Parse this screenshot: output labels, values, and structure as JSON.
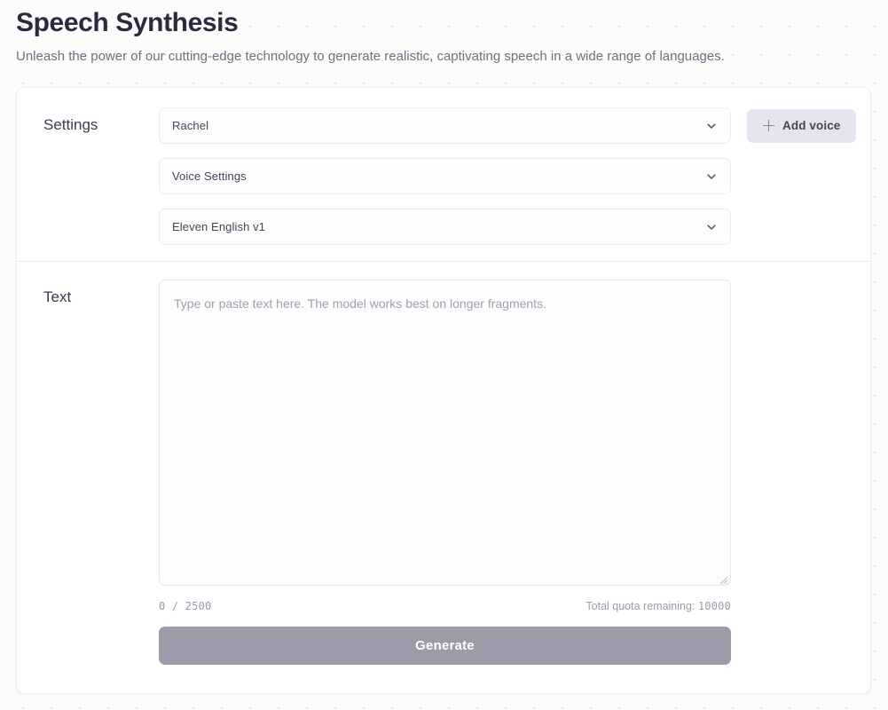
{
  "header": {
    "title": "Speech Synthesis",
    "subtitle": "Unleash the power of our cutting-edge technology to generate realistic, captivating speech in a wide range of languages."
  },
  "settings": {
    "label": "Settings",
    "voice_select": {
      "value": "Rachel",
      "icon": "chevron-down-icon"
    },
    "voice_settings_select": {
      "value": "Voice Settings",
      "icon": "chevron-down-icon"
    },
    "model_select": {
      "value": "Eleven English v1",
      "icon": "chevron-down-icon"
    },
    "add_voice_button": {
      "label": "Add voice",
      "icon": "plus-icon"
    }
  },
  "text_section": {
    "label": "Text",
    "textarea": {
      "value": "",
      "placeholder": "Type or paste text here. The model works best on longer fragments."
    },
    "char_count": "0 / 2500",
    "quota_label": "Total quota remaining: ",
    "quota_value": "10000",
    "generate_button": "Generate"
  },
  "colors": {
    "page_background": "#fcfcfd",
    "card_background": "#ffffff",
    "border": "#ededf1",
    "title_text": "#2b2b40",
    "subtitle_text": "#6b7280",
    "muted_text": "#9a9aab",
    "add_voice_background": "#e5e5ef",
    "generate_background": "#9b9baa",
    "generate_text": "#ffffff",
    "dot_pattern": "#dcdce4"
  }
}
